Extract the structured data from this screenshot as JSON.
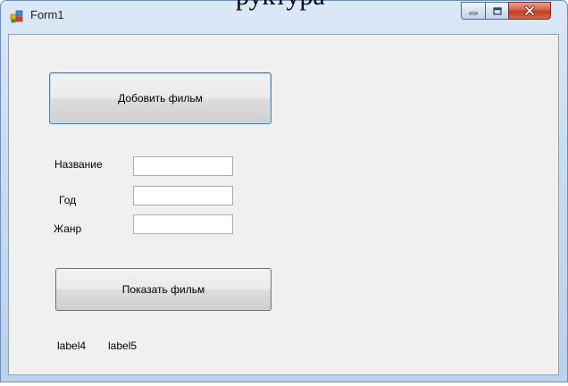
{
  "overlay": {
    "cropped_caption": "руктура"
  },
  "window": {
    "title": "Form1",
    "minimize_glyph": "_",
    "maximize_glyph": "□",
    "close_glyph": "x"
  },
  "form": {
    "add_button_label": "Добовить фильм",
    "name_label": "Название",
    "year_label": "Год",
    "genre_label": "Жанр",
    "name_value": "",
    "year_value": "",
    "genre_value": "",
    "show_button_label": "Показать фильм",
    "label4_text": "label4",
    "label5_text": "label5"
  },
  "colors": {
    "close_button": "#c23c22",
    "focus_border": "#3c7fb1",
    "client_background": "#f0f0f0"
  }
}
